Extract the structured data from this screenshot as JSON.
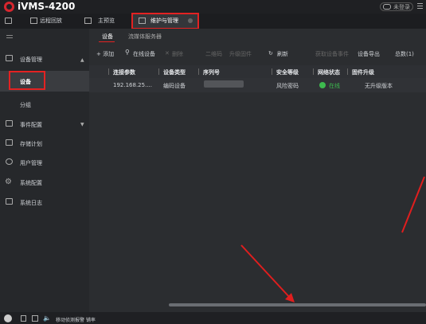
{
  "app": {
    "title": "iVMS-4200",
    "login_label": "未登录"
  },
  "tabs": [
    {
      "label": "远程回放",
      "icon": "playback-icon"
    },
    {
      "label": "主预览",
      "icon": "preview-icon"
    },
    {
      "label": "维护与管理",
      "icon": "maintenance-icon",
      "active": true
    }
  ],
  "sidebar": {
    "items": [
      {
        "label": "设备管理",
        "icon": "device-manage-icon"
      },
      {
        "label": "设备"
      },
      {
        "label": "分组"
      },
      {
        "label": "事件配置",
        "icon": "event-config-icon"
      },
      {
        "label": "存储计划",
        "icon": "storage-icon"
      },
      {
        "label": "用户管理",
        "icon": "user-icon"
      },
      {
        "label": "系统配置",
        "icon": "gear-icon"
      },
      {
        "label": "系统日志",
        "icon": "log-icon"
      }
    ]
  },
  "subtabs": [
    "设备",
    "流媒体服务器"
  ],
  "toolbar": {
    "add": "+ 添加",
    "online": "在线设备",
    "delete": "删除",
    "qrcode": "二维码",
    "upgrade": "升级固件",
    "refresh": "刷新",
    "get_events": "获取设备事件",
    "export": "设备导出",
    "total": "总数(1)"
  },
  "table": {
    "headers": [
      "连接参数",
      "设备类型",
      "序列号",
      "安全等级",
      "网络状态",
      "固件升级"
    ],
    "rows": [
      {
        "conn": "192.168.25....",
        "type": "编码设备",
        "serial": "",
        "security": "风险密码",
        "status": "在线",
        "firmware": "无升级版本"
      }
    ]
  },
  "statusbar": {
    "text": "移动侦测报警 铺率"
  },
  "colors": {
    "accent": "#e32222",
    "online": "#3dba4e"
  }
}
